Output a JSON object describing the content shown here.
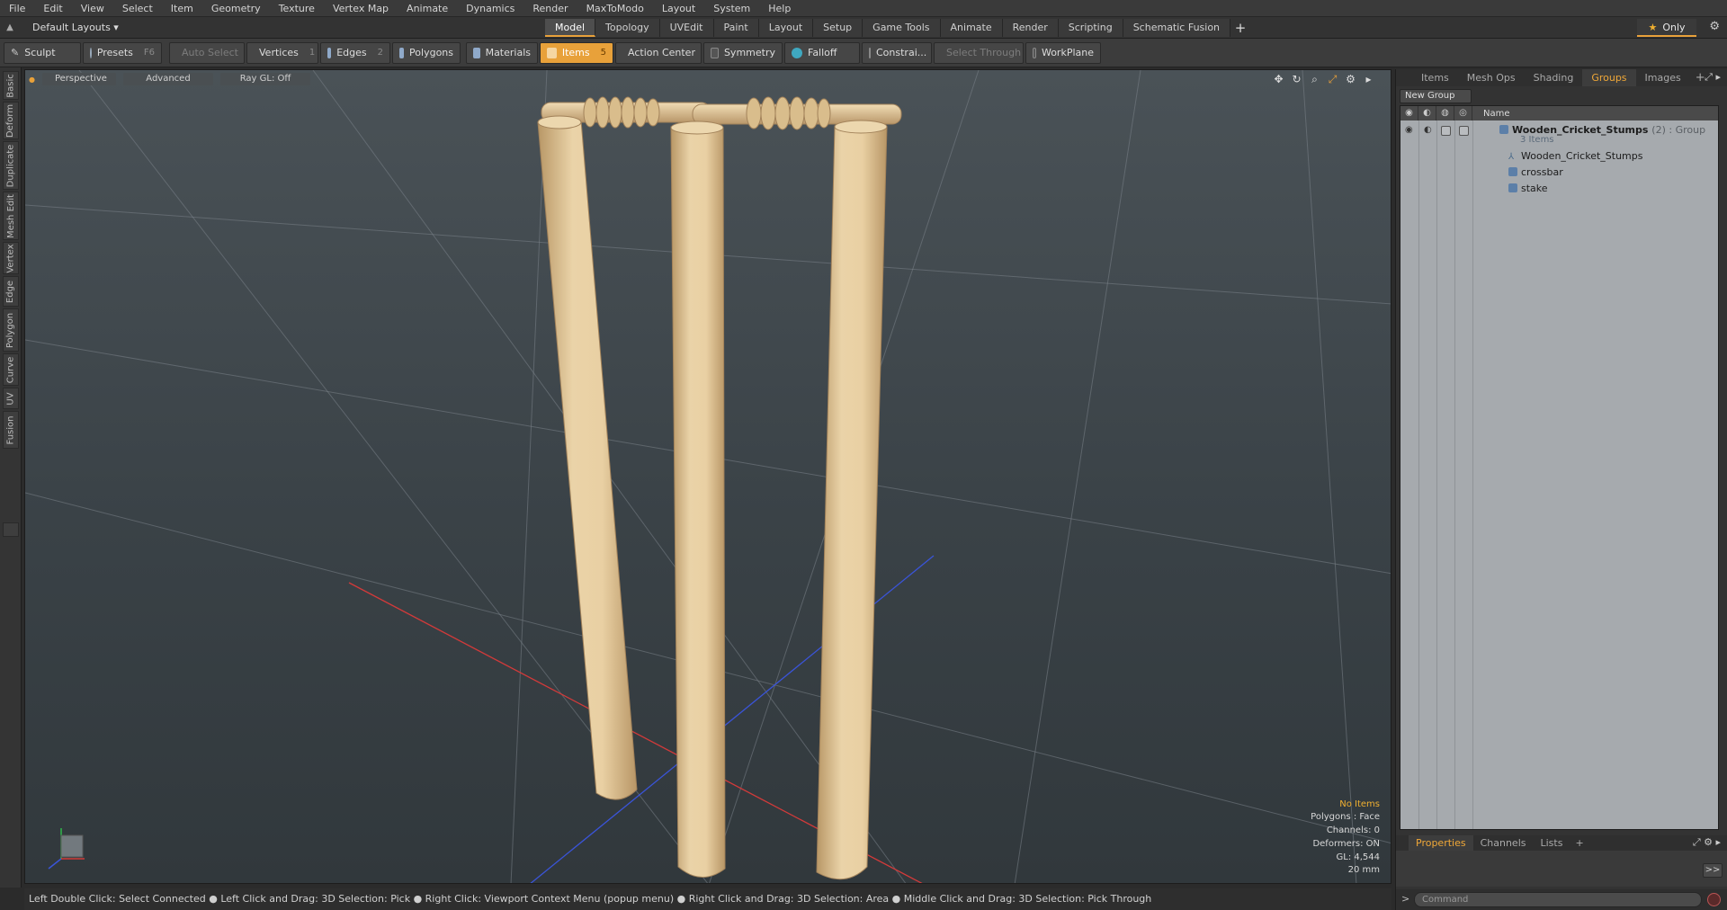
{
  "menu": [
    "File",
    "Edit",
    "View",
    "Select",
    "Item",
    "Geometry",
    "Texture",
    "Vertex Map",
    "Animate",
    "Dynamics",
    "Render",
    "MaxToModo",
    "Layout",
    "System",
    "Help"
  ],
  "layout": {
    "selector": "Default Layouts ▾",
    "tabs": [
      "Model",
      "Topology",
      "UVEdit",
      "Paint",
      "Layout",
      "Setup",
      "Game Tools",
      "Animate",
      "Render",
      "Scripting",
      "Schematic Fusion"
    ],
    "active_tab": "Model",
    "only_label": "Only"
  },
  "toolbar": {
    "sculpt": "Sculpt",
    "presets": "Presets",
    "presets_key": "F6",
    "auto_select": "Auto Select",
    "vertices": "Vertices",
    "vertices_key": "1",
    "edges": "Edges",
    "edges_key": "2",
    "polygons": "Polygons",
    "materials": "Materials",
    "items": "Items",
    "items_key": "5",
    "action_center": "Action Center",
    "symmetry": "Symmetry",
    "falloff": "Falloff",
    "constraints": "Constrai...",
    "select_through": "Select Through",
    "workplane": "WorkPlane"
  },
  "left_tabs": [
    "Basic",
    "Deform",
    "Duplicate",
    "Mesh Edit",
    "Vertex",
    "Edge",
    "Polygon",
    "Curve",
    "UV",
    "Fusion"
  ],
  "viewport": {
    "view": "Perspective",
    "shading": "Advanced",
    "raygl": "Ray GL: Off",
    "info": {
      "no_items": "No Items",
      "polygons": "Polygons : Face",
      "channels": "Channels: 0",
      "deformers": "Deformers: ON",
      "gl": "GL: 4,544",
      "unit": "20 mm"
    }
  },
  "status": "Left Double Click: Select Connected ● Left Click and Drag: 3D Selection: Pick ● Right Click: Viewport Context Menu (popup menu) ● Right Click and Drag: 3D Selection: Area ● Middle Click and Drag: 3D Selection: Pick Through",
  "right_panel": {
    "tabs": [
      "Items",
      "Mesh Ops",
      "Shading",
      "Groups",
      "Images"
    ],
    "active_tab": "Groups",
    "new_group": "New Group",
    "col_name": "Name",
    "group": {
      "name": "Wooden_Cricket_Stumps",
      "suffix": "(2) : Group",
      "count": "3 Items"
    },
    "children": [
      "Wooden_Cricket_Stumps",
      "crossbar",
      "stake"
    ],
    "bottom_tabs": [
      "Properties",
      "Channels",
      "Lists"
    ],
    "bottom_active": "Properties",
    "expand": ">>",
    "command_placeholder": "Command"
  },
  "colors": {
    "accent": "#e8a13a",
    "wood": "#e4cba0",
    "viewport_bg": "#3a4247"
  }
}
